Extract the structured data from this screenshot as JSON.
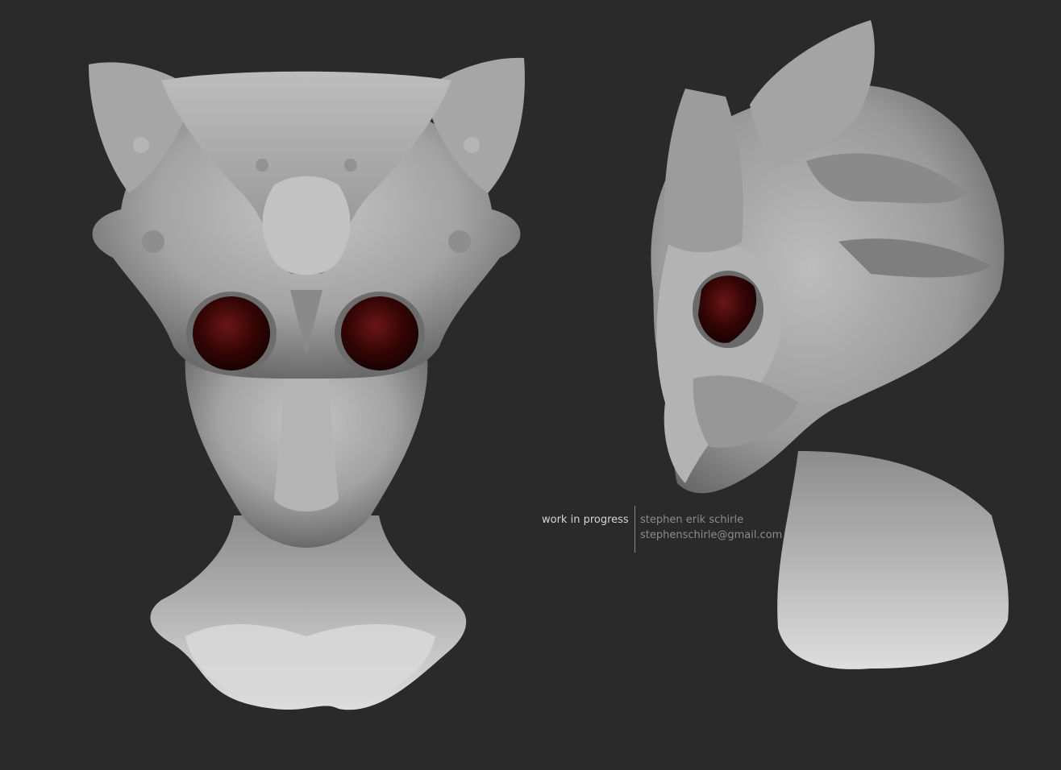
{
  "image": {
    "background_color": "#2a2a2b",
    "clay_color": "#a9a9a9",
    "clay_highlight": "#dadada",
    "clay_shadow": "#555555",
    "eye_color": "#3a0606"
  },
  "figures": [
    {
      "view": "front",
      "subject": "alien-head-sculpt"
    },
    {
      "view": "side",
      "subject": "alien-head-sculpt"
    }
  ],
  "caption": {
    "status": "work in progress",
    "author": "stephen erik schirle",
    "email": "stephenschirle@gmail.com"
  }
}
